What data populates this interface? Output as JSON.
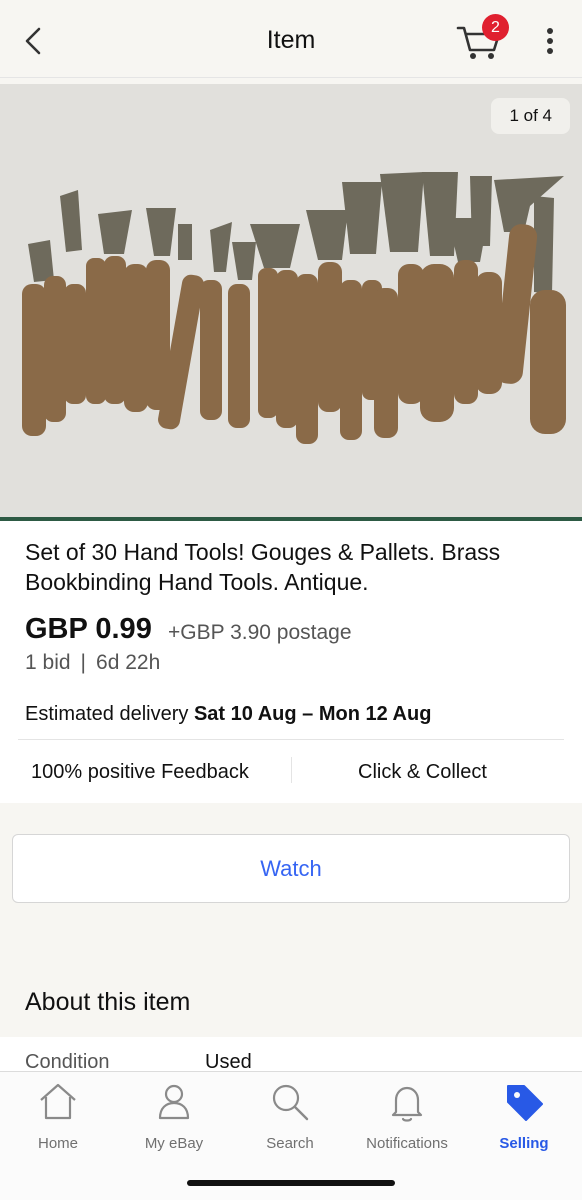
{
  "header": {
    "title": "Item",
    "cart_count": "2"
  },
  "photo": {
    "counter": "1 of 4",
    "alt": "Set of 30 hand tools photo"
  },
  "item": {
    "title": "Set of 30 Hand Tools! Gouges & Pallets. Brass Bookbinding Hand Tools. Antique.",
    "price": "GBP 0.99",
    "postage": "+GBP 3.90 postage",
    "bids": "1 bid",
    "separator": "|",
    "time_left": "6d 22h",
    "delivery_label": "Estimated delivery",
    "delivery_dates": "Sat 10 Aug – Mon 12 Aug",
    "feedback": "100% positive Feedback",
    "collect": "Click & Collect"
  },
  "actions": {
    "watch_label": "Watch"
  },
  "about": {
    "title": "About this item",
    "condition_label": "Condition",
    "condition_value": "Used"
  },
  "tabbar": {
    "items": [
      {
        "label": "Home",
        "icon": "home-icon"
      },
      {
        "label": "My eBay",
        "icon": "person-icon"
      },
      {
        "label": "Search",
        "icon": "search-icon"
      },
      {
        "label": "Notifications",
        "icon": "bell-icon"
      },
      {
        "label": "Selling",
        "icon": "tag-icon",
        "active": true
      }
    ]
  },
  "colors": {
    "accent": "#3665f3",
    "active_tab": "#2859e6",
    "badge": "#e0202f",
    "background": "#f7f6f2"
  }
}
